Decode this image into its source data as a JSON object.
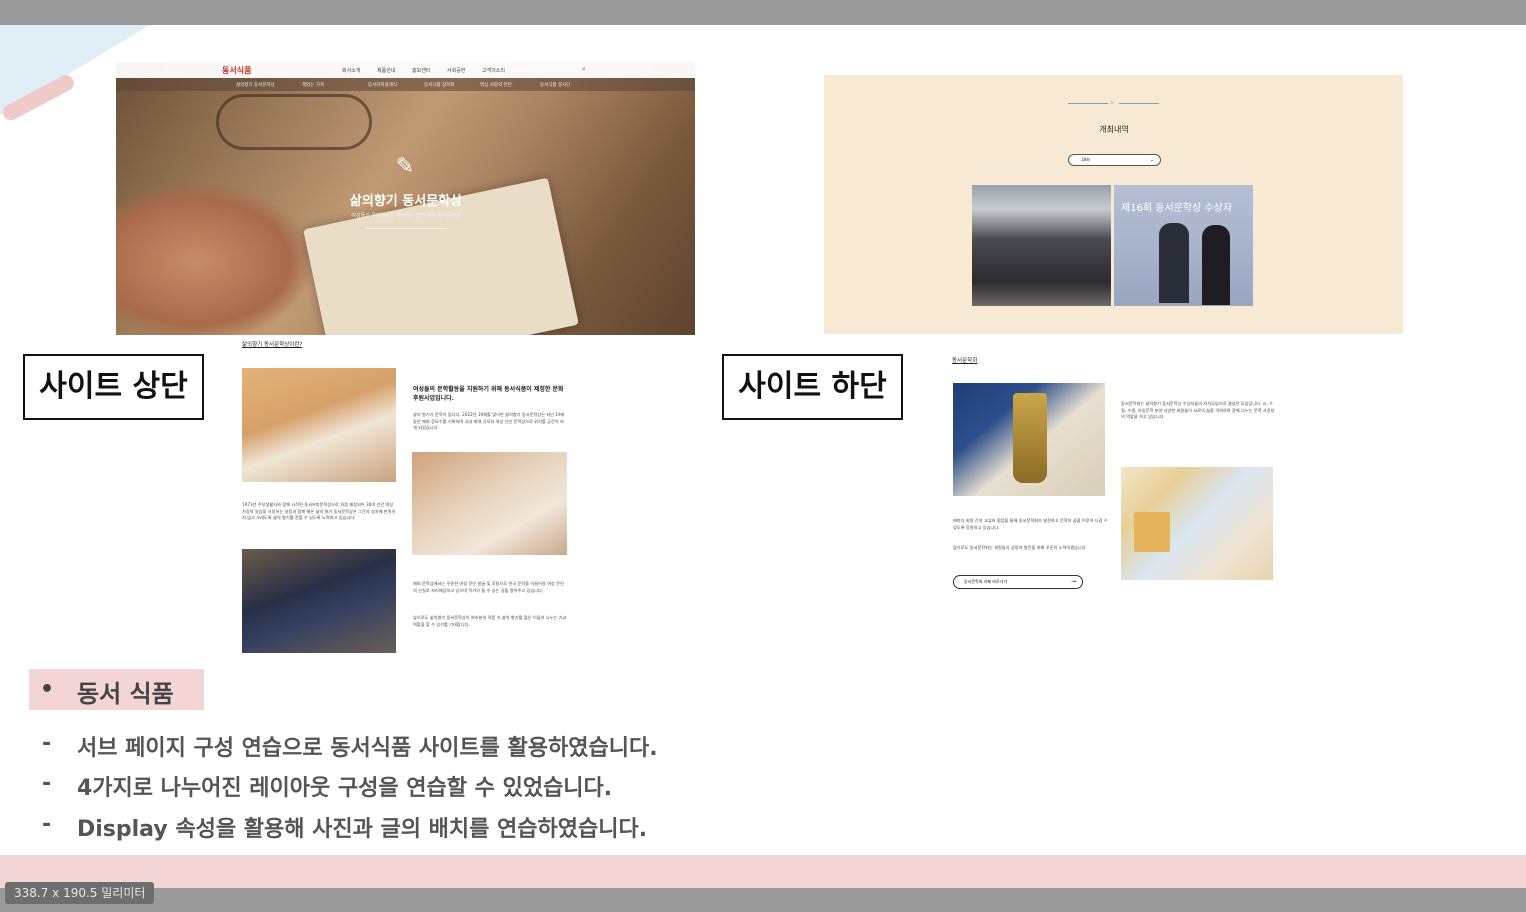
{
  "status": {
    "size_readout": "338.7 x 190.5 밀리미터"
  },
  "site_top": {
    "logo": "동서식품",
    "nav": [
      "회사소개",
      "제품안내",
      "홍보센터",
      "사회공헌",
      "고객의소리"
    ],
    "subnav": [
      "삶의향기 동서문학상",
      "책읽는 가족",
      "동서커피클래식",
      "동서식품 장학회",
      "맥심 사랑의 연탄",
      "동서식품 봉사단"
    ],
    "hero_title": "삶의향기 동서문학상",
    "hero_subtitle": "여성들의 문학활동을 지원하는 삶의 향기 동서문학상",
    "intro_heading": "삶의향기 동서문학상이란?",
    "intro_bold": "여성들의 문학활동을 지원하기 위해 동서식품이 제정한 문화후원사업입니다.",
    "intro_body": "삶의 향기가 문학이 됩니다. 2022년 19회를 맞이한 삶의향기 동서문학상은 지난 19회 동안 매회 응모수를 기록하며 국내 최대 규모의 여성 신인 문학상으로 위치를 굳건히 하게 되었습니다.",
    "intro_left": "1973년 주부생활사와 함께 시작된 동서커피문학상으로 처음 제정되어 30여 년간 여성 가정의 일상을 사랑하는 마음과 함께 해온 삶의 향기 동서문학상은 그간의 성과에 만족하지 않고 오래도록 삶의 향기를 전할 수 있도록 노력하고 있습니다.",
    "intro_right_a": "매회 문학상에서는 꾸준한 여성 문인 발굴 및 후원으로 한국 문학을 이끌어갈 여성 문인의 산실로 자리매김하고 있으며 작가가 될 수 있는 길을 열어주고 있습니다.",
    "intro_right_b": "앞으로도 삶의향기 동서문학상이 여러분의 작품 속 삶의 향기를 많은 이들과 나누는 기교 역할을 할 수 있기를 기대합니다."
  },
  "labels": {
    "top": "사이트 상단",
    "bottom": "사이트 하단"
  },
  "site_bottom": {
    "history_title": "개최내역",
    "select_value": "18회",
    "photo_caption": "제16회 동서문학상 수상자",
    "literary_heading": "동서문학회",
    "literary_top": "동서문학회는 삶의향기 동서문학상 수상자들의 자치모임으로 결성된 모임입니다. 시, 수필, 수필, 아동문학 분야 다양한 회원들이 서로의 삶을 격려하며 함께 나누는 문학 사랑방의 역할을 하고 있습니다.",
    "literary_a": "해마다 회원 간의 교류와 협업을 통해 동서문학회가 발전하고 문학의 꿈을 이루어 나갈 수 있도록 응원하고 있습니다.",
    "literary_b": "앞으로도 동서문학회는 회원들의 성장과 발전을 위해 꾸준히 노력하겠습니다.",
    "button_label": "동서문학회 카페 바로가기",
    "button_arrow": "→"
  },
  "notes": {
    "bullet": "•",
    "title": "동서 식품",
    "dash": "-",
    "items": [
      "서브 페이지 구성 연습으로 동서식품 사이트를 활용하였습니다.",
      "4가지로 나누어진 레이아웃 구성을 연습할 수 있었습니다.",
      "Display 속성을 활용해 사진과 글의 배치를 연습하였습니다."
    ]
  },
  "colors": {
    "accent_pink": "#f2d5d4",
    "frame_grey": "#9a9a9a",
    "panel_beige": "#f8e9d5",
    "logo_red": "#c0392b"
  },
  "icons": [
    "search-icon",
    "quill-icon",
    "chevron-down-icon",
    "arrow-right-icon"
  ]
}
